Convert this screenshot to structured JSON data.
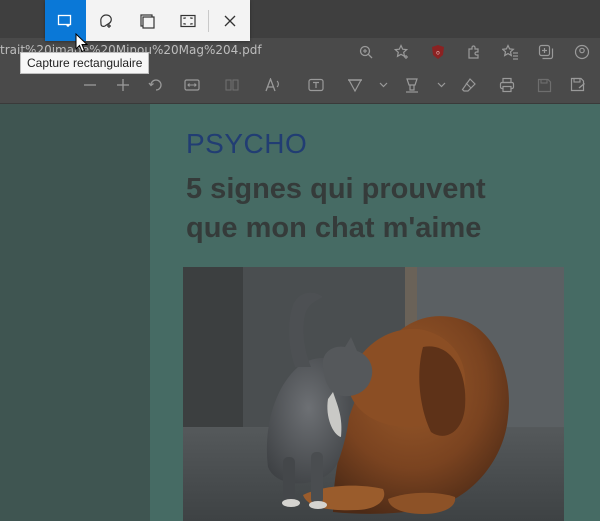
{
  "browser": {
    "url": "trait%20image%20Minou%20Mag%204.pdf"
  },
  "snip_tool": {
    "tooltip": "Capture rectangulaire",
    "accent": "#0a78d7"
  },
  "document": {
    "category": "PSYCHO",
    "headline_line1": "5 signes qui prouvent",
    "headline_line2": "que mon chat m'aime",
    "category_color": "#213d73"
  }
}
